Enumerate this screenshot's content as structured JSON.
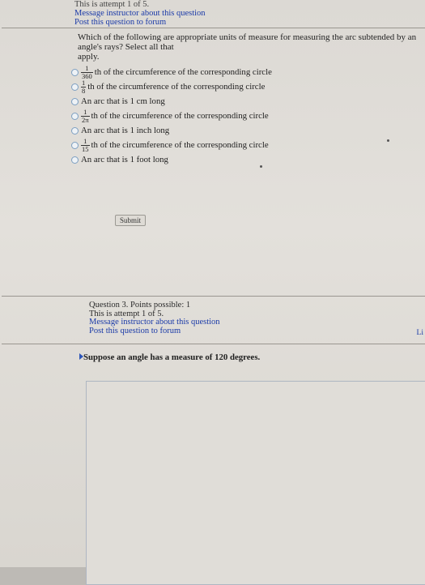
{
  "top": {
    "attempt": "This is attempt 1 of 5.",
    "message_link": "Message instructor about this question",
    "forum_link": "Post this question to forum"
  },
  "question": {
    "prompt_line1": "Which of the following are appropriate units of measure for measuring the arc subtended by an angle's rays? Select all that",
    "prompt_line2": "apply.",
    "options": [
      {
        "num": "1",
        "den": "360",
        "text": "th of the circumference of the corresponding circle"
      },
      {
        "num": "1",
        "den": "8",
        "text": "th of the circumference of the corresponding circle"
      },
      {
        "text": "An arc that is 1 cm long"
      },
      {
        "num": "1",
        "den": "2π",
        "text": "th of the circumference of the corresponding circle"
      },
      {
        "text": "An arc that is 1 inch long"
      },
      {
        "num": "1",
        "den": "15",
        "text": "th of the circumference of the corresponding circle"
      },
      {
        "text": "An arc that is 1 foot long"
      }
    ],
    "submit_label": "Submit"
  },
  "next_question": {
    "points": "Question 3. Points possible: 1",
    "attempt": "This is attempt 1 of 5.",
    "message_link": "Message instructor about this question",
    "forum_link": "Post this question to forum"
  },
  "side_link": "Li",
  "section_title": "Suppose an angle has a measure of 120 degrees."
}
